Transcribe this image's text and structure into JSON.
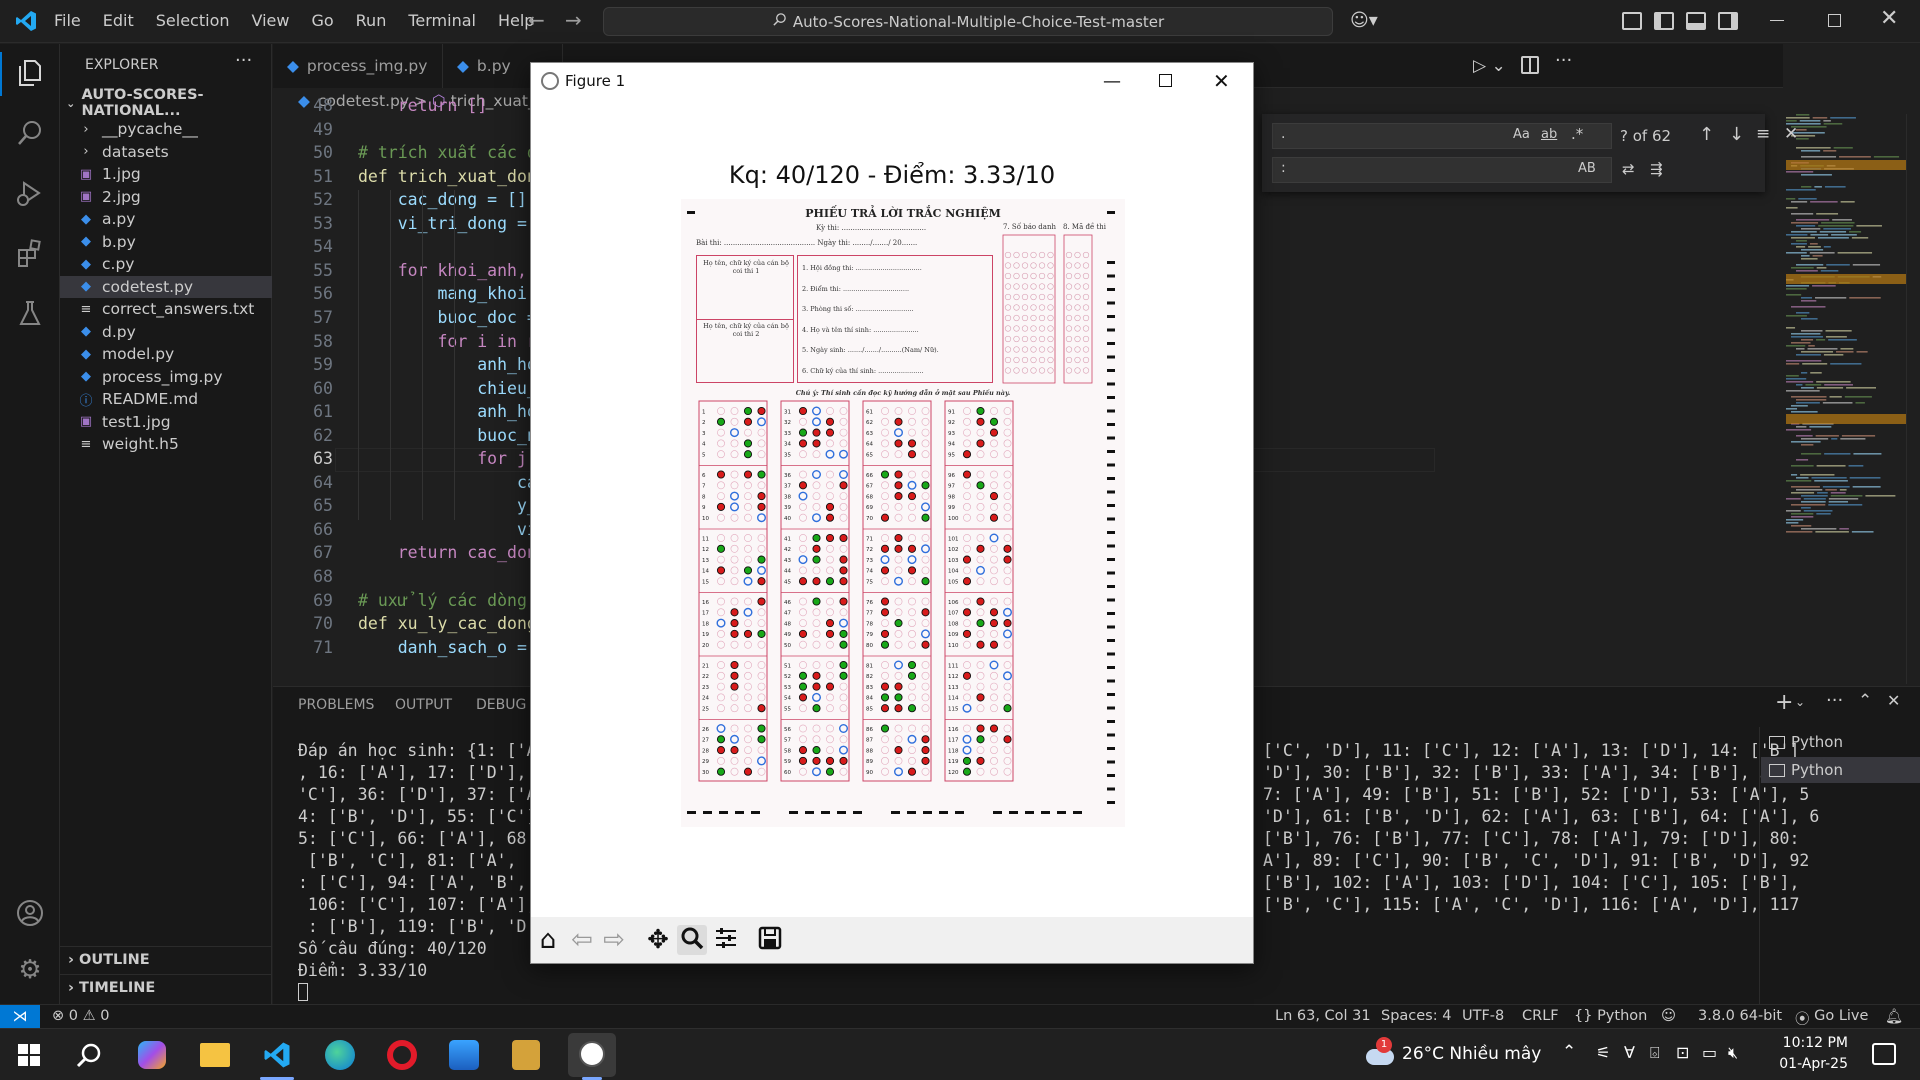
{
  "titlebar": {
    "menu": [
      "File",
      "Edit",
      "Selection",
      "View",
      "Go",
      "Run",
      "Terminal",
      "Help"
    ],
    "search": "Auto-Scores-National-Multiple-Choice-Test-master"
  },
  "explorer": {
    "header": "EXPLORER",
    "root": "AUTO-SCORES-NATIONAL...",
    "items": [
      {
        "label": "__pycache__",
        "icon": "chevron-right-icon"
      },
      {
        "label": "datasets",
        "icon": "chevron-right-icon"
      },
      {
        "label": "1.jpg",
        "icon": "image-file-icon"
      },
      {
        "label": "2.jpg",
        "icon": "image-file-icon"
      },
      {
        "label": "a.py",
        "icon": "python-file-icon"
      },
      {
        "label": "b.py",
        "icon": "python-file-icon"
      },
      {
        "label": "c.py",
        "icon": "python-file-icon"
      },
      {
        "label": "codetest.py",
        "icon": "python-file-icon"
      },
      {
        "label": "correct_answers.txt",
        "icon": "text-file-icon"
      },
      {
        "label": "d.py",
        "icon": "python-file-icon"
      },
      {
        "label": "model.py",
        "icon": "python-file-icon"
      },
      {
        "label": "process_img.py",
        "icon": "python-file-icon"
      },
      {
        "label": "README.md",
        "icon": "info-file-icon"
      },
      {
        "label": "test1.jpg",
        "icon": "image-file-icon"
      },
      {
        "label": "weight.h5",
        "icon": "text-file-icon"
      }
    ],
    "outline": "OUTLINE",
    "timeline": "TIMELINE"
  },
  "tabs": [
    "process_img.py",
    "b.py"
  ],
  "breadcrumb": {
    "file": "codetest.py",
    "sep": ">",
    "symbol": "trich_xuat_c"
  },
  "code": {
    "lines": [
      {
        "n": "48",
        "text": "    return []"
      },
      {
        "n": "49",
        "text": ""
      },
      {
        "n": "50",
        "text": "# trích xuất các d"
      },
      {
        "n": "51",
        "text": "def trich_xuat_don"
      },
      {
        "n": "52",
        "text": "    cac_dong = []"
      },
      {
        "n": "53",
        "text": "    vi_tri_dong ="
      },
      {
        "n": "54",
        "text": ""
      },
      {
        "n": "55",
        "text": "    for khoi_anh,"
      },
      {
        "n": "56",
        "text": "        mang_khoi"
      },
      {
        "n": "57",
        "text": "        buoc_doc ="
      },
      {
        "n": "58",
        "text": "        for i in r"
      },
      {
        "n": "59",
        "text": "            anh_ho"
      },
      {
        "n": "60",
        "text": "            chieu_"
      },
      {
        "n": "61",
        "text": "            anh_ho"
      },
      {
        "n": "62",
        "text": "            buoc_n"
      },
      {
        "n": "63",
        "text": "            for j"
      },
      {
        "n": "64",
        "text": "                ca"
      },
      {
        "n": "65",
        "text": "                y_"
      },
      {
        "n": "66",
        "text": "                vi"
      },
      {
        "n": "67",
        "text": "    return cac_don"
      },
      {
        "n": "68",
        "text": ""
      },
      {
        "n": "69",
        "text": "# uxử lý các dòng"
      },
      {
        "n": "70",
        "text": "def xu_ly_cac_dong"
      },
      {
        "n": "71",
        "text": "    danh_sach_o ="
      }
    ]
  },
  "find": {
    "field1": ".",
    "field2": ":",
    "count": "? of 62",
    "aa": "Aa",
    "ab": "ab",
    "regex": ".*",
    "AB": "AB"
  },
  "panel": {
    "tabs": [
      "PROBLEMS",
      "OUTPUT",
      "DEBUG C"
    ],
    "terminals": [
      "Python",
      "Python"
    ],
    "left_lines": [
      "Đáp án học sinh: {1: ['A']",
      ", 16: ['A'], 17: ['D'], 18",
      "'C'], 36: ['D'], 37: ['A'",
      "4: ['B', 'D'], 55: ['C'],",
      "5: ['C'], 66: ['A'], 68: [",
      " ['B', 'C'], 81: ['A', 'D'",
      ": ['C'], 94: ['A', 'B', 'C",
      " 106: ['C'], 107: ['A'], 1",
      " : ['B'], 119: ['B', 'D'],",
      "Số câu đúng: 40/120",
      "Điểm: 3.33/10"
    ],
    "right_lines": [
      "['C', 'D'], 11: ['C'], 12: ['A'], 13: ['D'], 14: ['B']",
      "'D'], 30: ['B'], 32: ['B'], 33: ['A'], 34: ['B'], 35: [",
      "7: ['A'], 49: ['B'], 51: ['B'], 52: ['D'], 53: ['A'], 5",
      "'D'], 61: ['B', 'D'], 62: ['A'], 63: ['B'], 64: ['A'], 6",
      "['B'], 76: ['B'], 77: ['C'], 78: ['A'], 79: ['D'], 80:",
      "A'], 89: ['C'], 90: ['B', 'C', 'D'], 91: ['B', 'D'], 92",
      "['B'], 102: ['A'], 103: ['D'], 104: ['C'], 105: ['B'],",
      "['B', 'C'], 115: ['A', 'C', 'D'], 116: ['A', 'D'], 117"
    ]
  },
  "statusbar": {
    "errors": "0",
    "warnings": "0",
    "position": "Ln 63, Col 31",
    "spaces": "Spaces: 4",
    "encoding": "UTF-8",
    "eol": "CRLF",
    "lang": "Python",
    "interp": "3.8.0 64-bit",
    "golive": "Go Live"
  },
  "taskbar": {
    "weather": "26°C  Nhiều mây",
    "weather_badge": "1",
    "time": "10:12 PM",
    "date": "01-Apr-25"
  },
  "figure": {
    "title": "Figure 1",
    "plot_title": "Kq: 40/120 - Điểm: 3.33/10",
    "sheet": {
      "heading": "PHIẾU TRẢ LỜI TRẮC NGHIỆM",
      "kythi": "Kỳ thi: ......................................",
      "baithi": "Bài thi: .........................................  Ngày thi: ......../......./ 20.......",
      "sbd": "7. Số báo danh",
      "made": "8. Mã đề thi",
      "gt1": "Họ tên, chữ ký của cán bộ coi thi 1",
      "gt2": "Họ tên, chữ ký của cán bộ coi thi 2",
      "fields": [
        "1. Hội đồng thi: ................................",
        "2. Điểm thi: ................................",
        "3. Phòng thi số: ............................",
        "4. Họ và tên thí sinh: ......................",
        "5. Ngày sinh: ......./......./..........(Nam/ Nữ).",
        "6. Chữ ký của thí sinh: ......................"
      ],
      "note": "Chú ý: Thí sinh cần đọc kỹ hướng dẫn ở mặt sau Phiếu này."
    }
  },
  "colors": {
    "accent": "#0078d4",
    "mark_red": "#d81b1b",
    "mark_green": "#18a818",
    "mark_blue": "#2f6fdc",
    "sheet_line": "#cc4466"
  }
}
